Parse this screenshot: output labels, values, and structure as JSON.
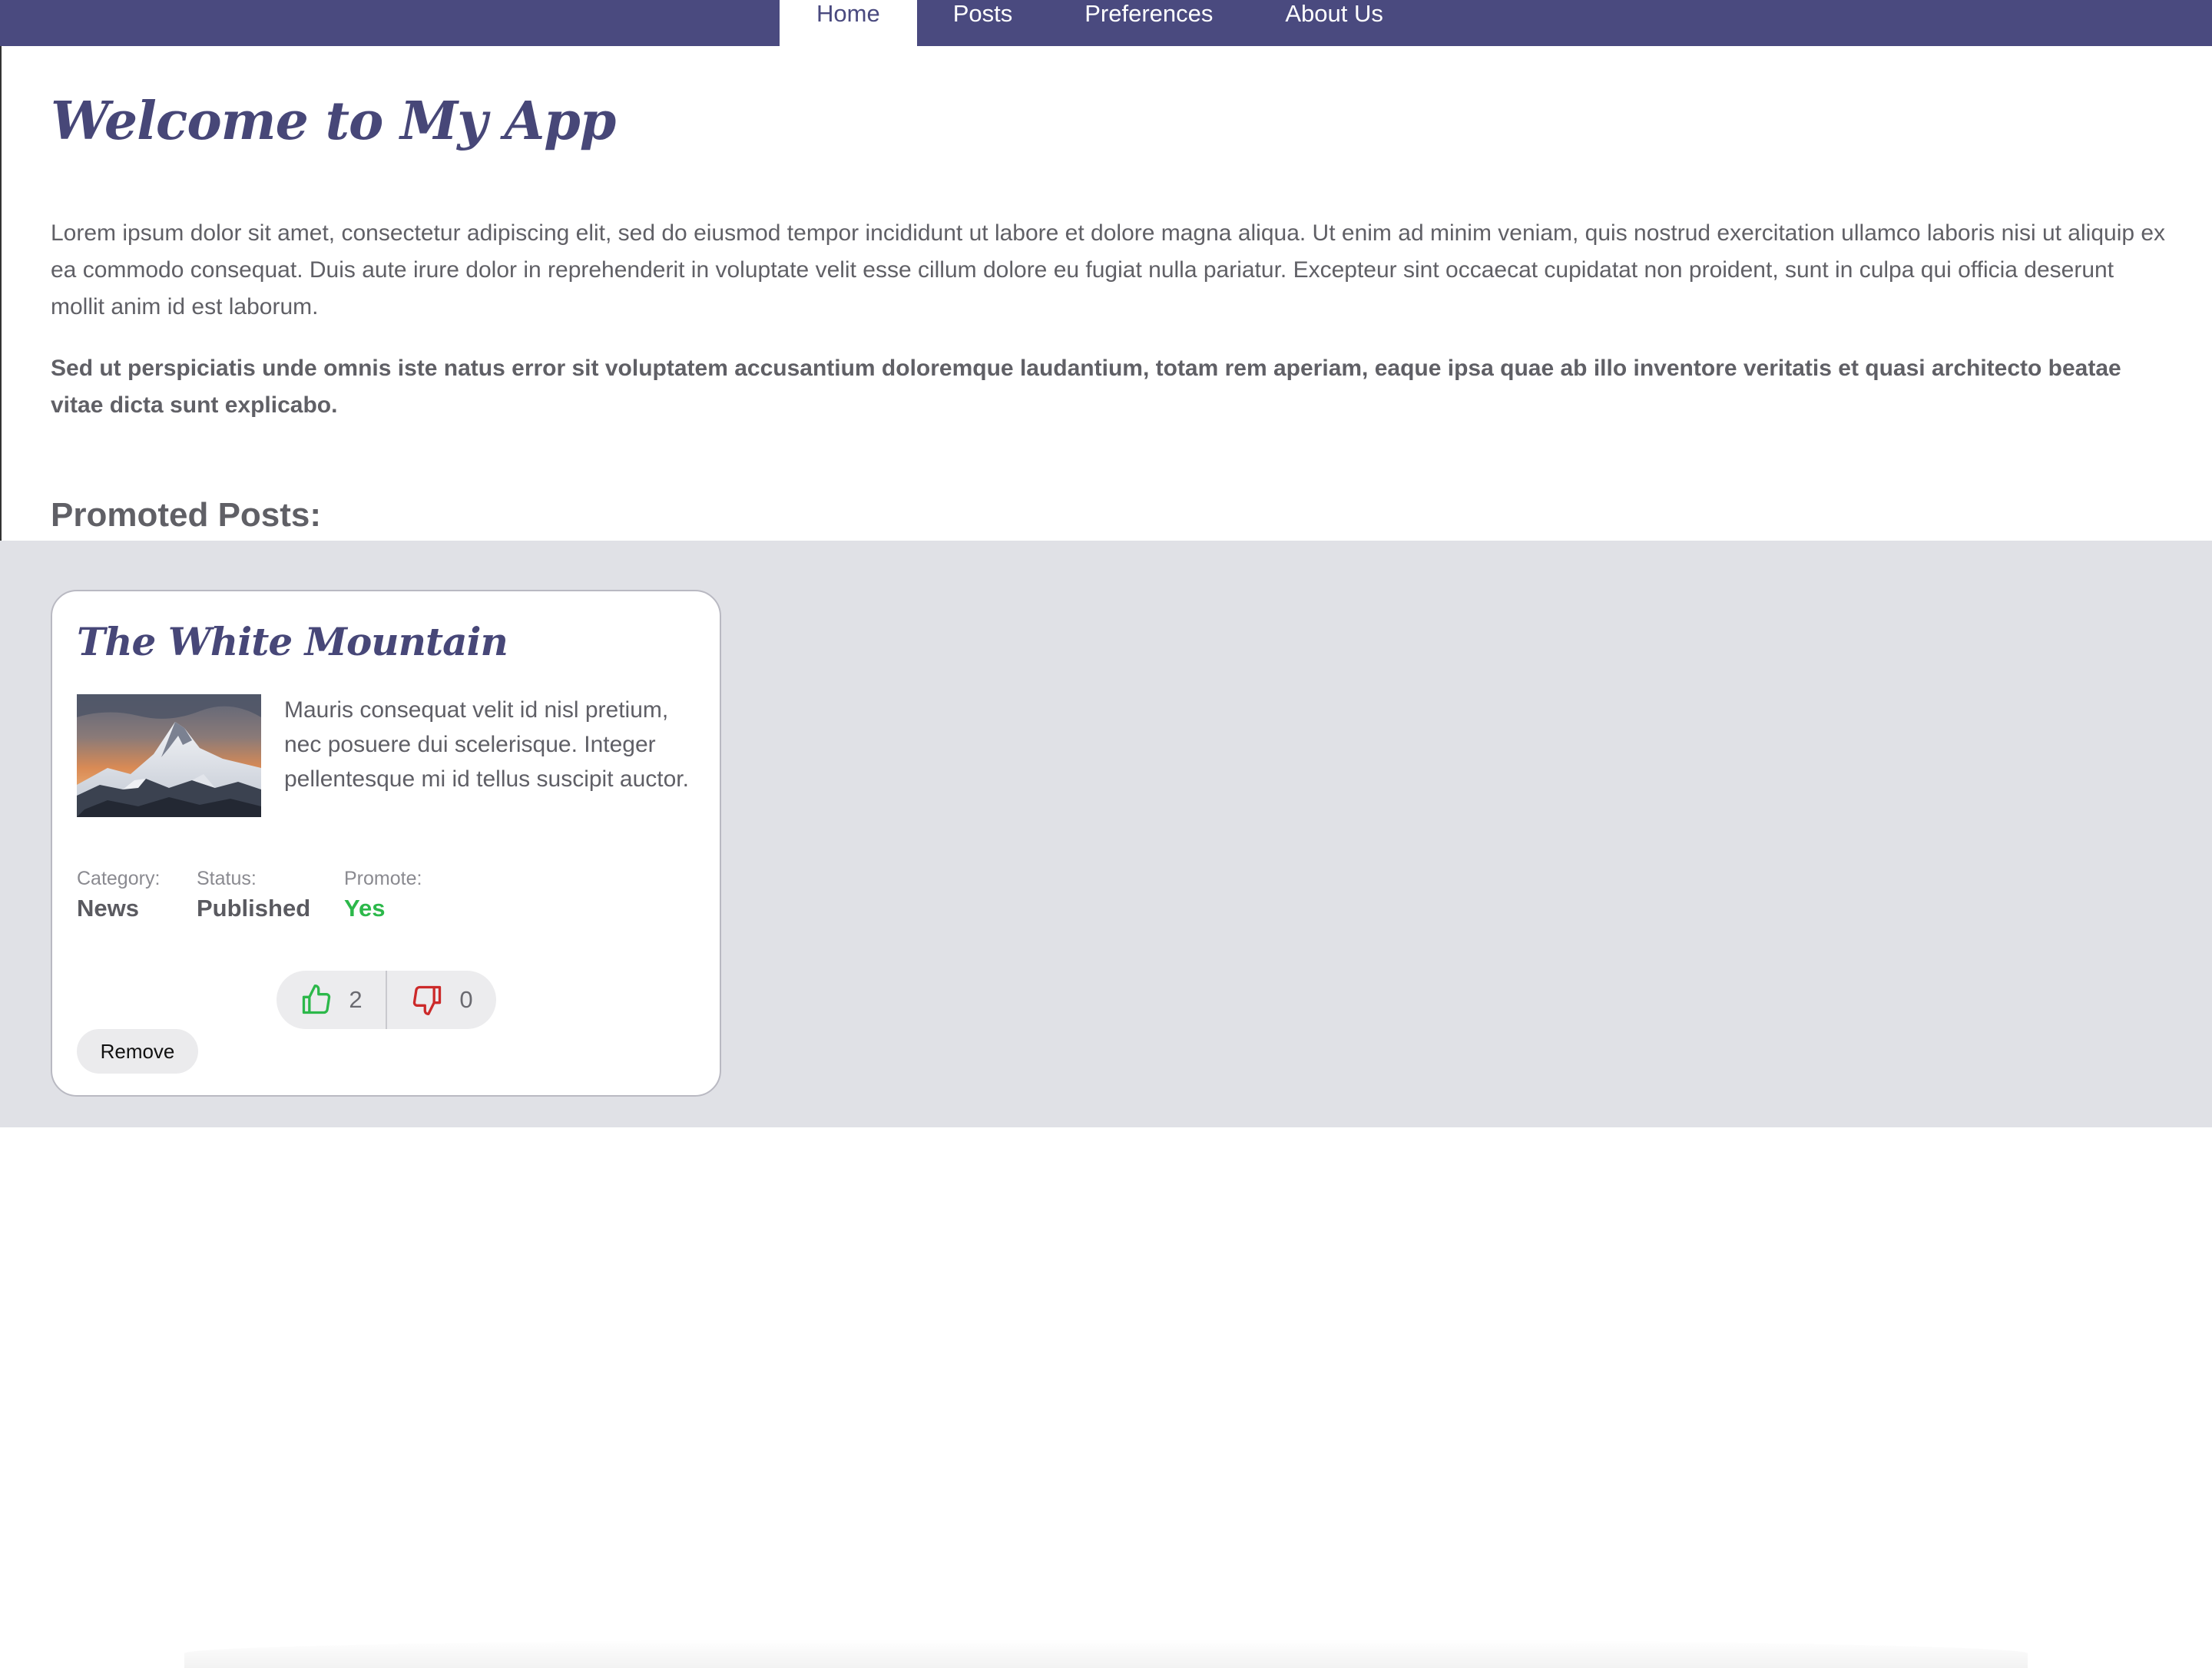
{
  "nav": {
    "tabs": [
      {
        "label": "Home",
        "active": true
      },
      {
        "label": "Posts",
        "active": false
      },
      {
        "label": "Preferences",
        "active": false
      },
      {
        "label": "About Us",
        "active": false
      }
    ]
  },
  "page": {
    "title": "Welcome to My App",
    "intro": "Lorem ipsum dolor sit amet, consectetur adipiscing elit, sed do eiusmod tempor incididunt ut labore et dolore magna aliqua. Ut enim ad minim veniam, quis nostrud exercitation ullamco laboris nisi ut aliquip ex ea commodo consequat. Duis aute irure dolor in reprehenderit in voluptate velit esse cillum dolore eu fugiat nulla pariatur. Excepteur sint occaecat cupidatat non proident, sunt in culpa qui officia deserunt mollit anim id est laborum.",
    "intro_bold": "Sed ut perspiciatis unde omnis iste natus error sit voluptatem accusantium doloremque laudantium, totam rem aperiam, eaque ipsa quae ab illo inventore veritatis et quasi architecto beatae vitae dicta sunt explicabo.",
    "section_title": "Promoted Posts:"
  },
  "post": {
    "title": "The White Mountain",
    "excerpt": "Mauris consequat velit id nisl pretium, nec posuere dui scelerisque. Integer pellentesque mi id tellus suscipit auctor.",
    "category_label": "Category:",
    "category": "News",
    "status_label": "Status:",
    "status": "Published",
    "promote_label": "Promote:",
    "promote": "Yes",
    "likes": "2",
    "dislikes": "0",
    "remove_label": "Remove"
  },
  "colors": {
    "brand": "#4a4a7f",
    "background_gray": "#e0e1e6",
    "promote_yes": "#2cb84a",
    "like_icon": "#2cb84a",
    "dislike_icon": "#cc2a2a"
  },
  "icons": {
    "like": "thumbs-up-icon",
    "dislike": "thumbs-down-icon"
  }
}
